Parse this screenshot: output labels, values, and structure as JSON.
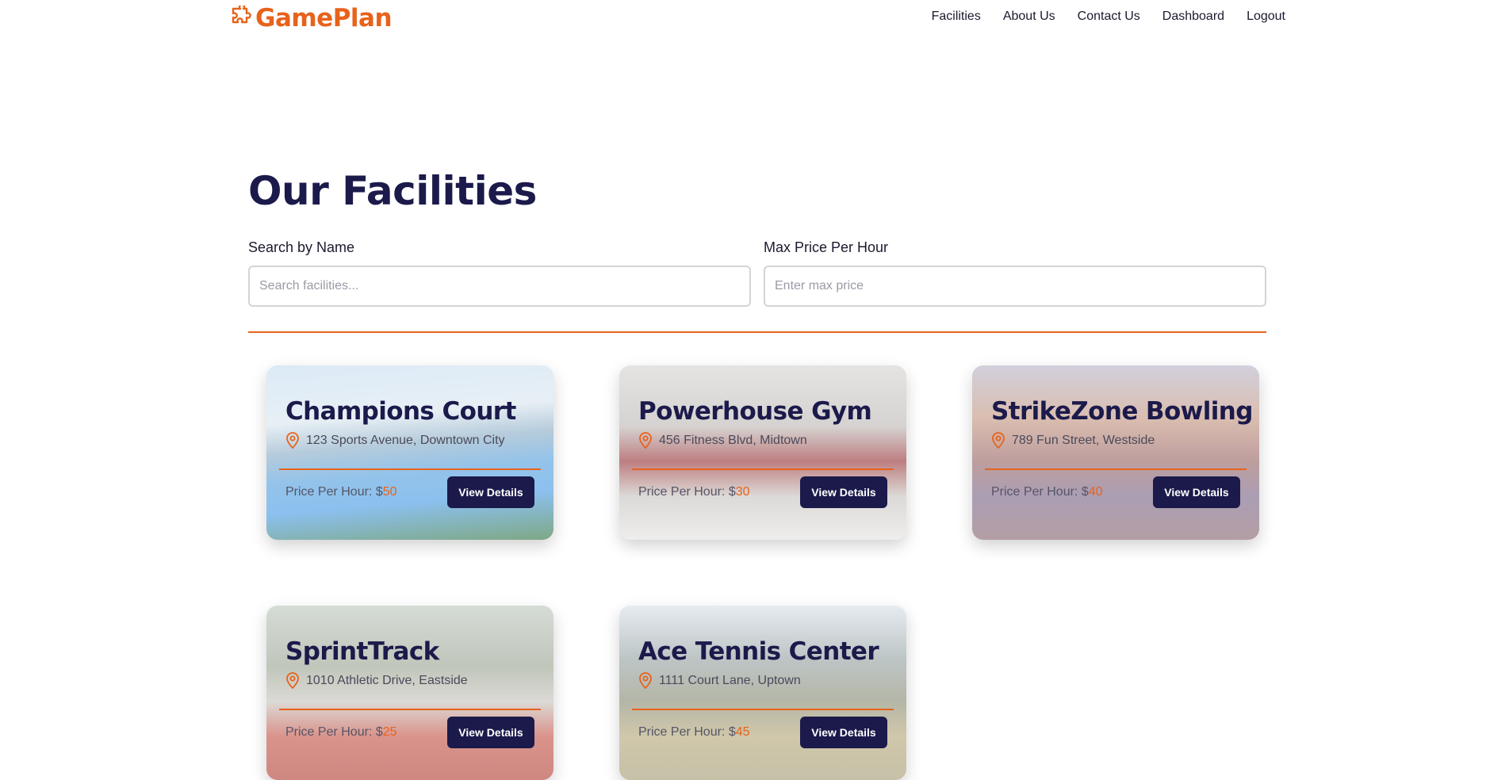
{
  "brand": {
    "name": "GamePlan",
    "color": "#e8621a"
  },
  "nav": {
    "items": [
      "Facilities",
      "About Us",
      "Contact Us",
      "Dashboard",
      "Logout"
    ]
  },
  "page": {
    "title": "Our Facilities"
  },
  "filters": {
    "name_label": "Search by Name",
    "name_placeholder": "Search facilities...",
    "name_value": "",
    "price_label": "Max Price Per Hour",
    "price_placeholder": "Enter max price",
    "price_value": ""
  },
  "facilities": [
    {
      "name": "Champions Court",
      "address": "123 Sports Avenue, Downtown City",
      "price_label": "Price Per Hour: $",
      "price": "50",
      "button": "View Details"
    },
    {
      "name": "Powerhouse Gym",
      "address": "456 Fitness Blvd, Midtown",
      "price_label": "Price Per Hour: $",
      "price": "30",
      "button": "View Details"
    },
    {
      "name": "StrikeZone Bowling",
      "address": "789 Fun Street, Westside",
      "price_label": "Price Per Hour: $",
      "price": "40",
      "button": "View Details"
    },
    {
      "name": "SprintTrack",
      "address": "1010 Athletic Drive, Eastside",
      "price_label": "Price Per Hour: $",
      "price": "25",
      "button": "View Details"
    },
    {
      "name": "Ace Tennis Center",
      "address": "1111 Court Lane, Uptown",
      "price_label": "Price Per Hour: $",
      "price": "45",
      "button": "View Details"
    }
  ],
  "icons": {
    "brand": "puzzle-icon",
    "location": "map-pin-icon"
  },
  "colors": {
    "accent": "#e8621a",
    "primary": "#1b1a4b"
  }
}
